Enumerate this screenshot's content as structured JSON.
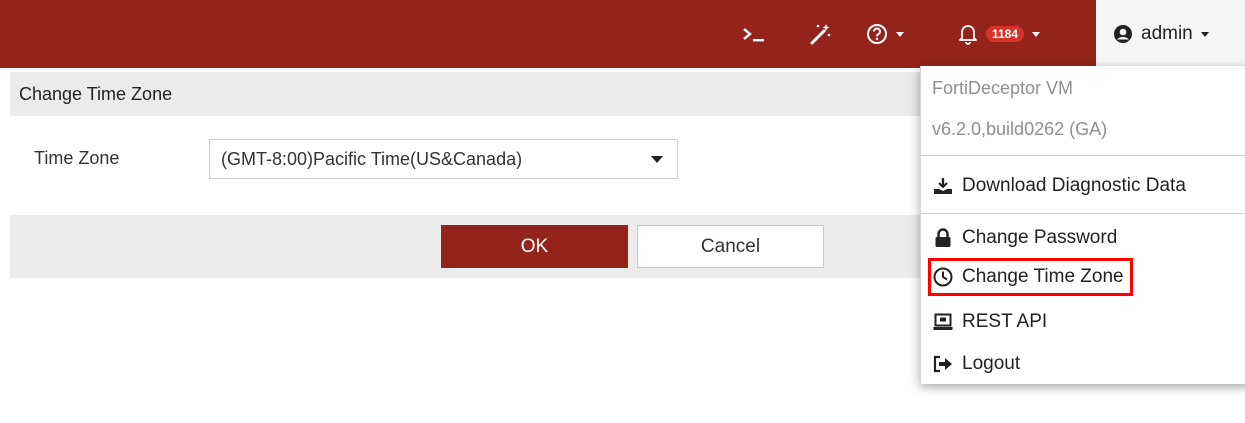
{
  "topbar": {
    "bg_color": "#94231b",
    "notifications_count": "1184",
    "user_label": "admin"
  },
  "dialog": {
    "title": "Change Time Zone",
    "timezone_label": "Time Zone",
    "timezone_value": "(GMT-8:00)Pacific Time(US&Canada)",
    "ok_label": "OK",
    "cancel_label": "Cancel"
  },
  "user_menu": {
    "product_name": "FortiDeceptor VM",
    "version": "v6.2.0,build0262 (GA)",
    "items": [
      {
        "label": "Download Diagnostic Data",
        "icon": "download-icon"
      },
      {
        "label": "Change Password",
        "icon": "lock-icon"
      },
      {
        "label": "Change Time Zone",
        "icon": "clock-icon",
        "highlighted": true
      },
      {
        "label": "REST API",
        "icon": "api-icon"
      },
      {
        "label": "Logout",
        "icon": "logout-icon"
      }
    ],
    "highlight_color": "#ff0000"
  }
}
